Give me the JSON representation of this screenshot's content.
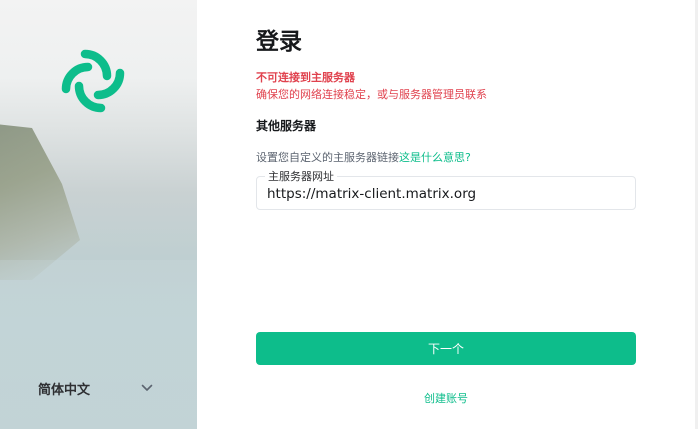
{
  "sidebar": {
    "logo_icon": "element-logo-icon",
    "language": "简体中文",
    "language_chevron_icon": "chevron-down-icon"
  },
  "login": {
    "title": "登录",
    "error_title": "不可连接到主服务器",
    "error_desc": "确保您的网络连接稳定，或与服务器管理员联系",
    "section_title": "其他服务器",
    "hint_text": "设置您自定义的主服务器链接",
    "hint_link": "这是什么意思?",
    "field_label": "主服务器网址",
    "field_value": "https://matrix-client.matrix.org",
    "next_button": "下一个",
    "create_account": "创建账号"
  },
  "colors": {
    "accent": "#0dbd8b",
    "error": "#e0424e",
    "text": "#17191c"
  }
}
